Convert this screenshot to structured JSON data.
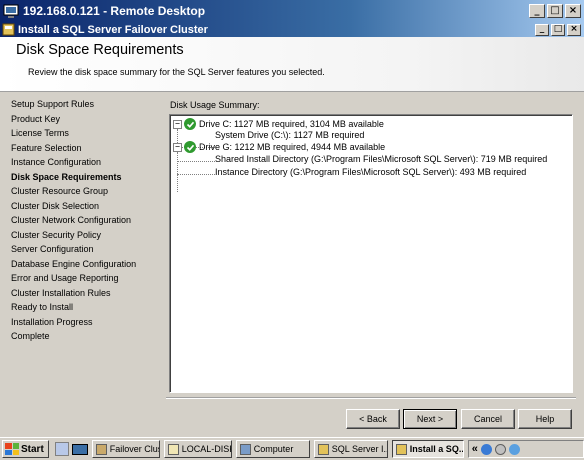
{
  "rdp_window": {
    "title": "192.168.0.121 - Remote Desktop",
    "icon": "remote-desktop-icon"
  },
  "setup_window": {
    "title": "Install a SQL Server Failover Cluster",
    "icon": "setup-icon"
  },
  "header": {
    "title": "Disk Space Requirements",
    "subtitle": "Review the disk space summary for the SQL Server features you selected."
  },
  "nav": {
    "active_index": 5,
    "items": [
      "Setup Support Rules",
      "Product Key",
      "License Terms",
      "Feature Selection",
      "Instance Configuration",
      "Disk Space Requirements",
      "Cluster Resource Group",
      "Cluster Disk Selection",
      "Cluster Network Configuration",
      "Cluster Security Policy",
      "Server Configuration",
      "Database Engine Configuration",
      "Error and Usage Reporting",
      "Cluster Installation Rules",
      "Ready to Install",
      "Installation Progress",
      "Complete"
    ]
  },
  "summary": {
    "label": "Disk Usage Summary:",
    "drives": [
      {
        "text": "Drive C: 1127 MB required, 3104 MB available",
        "status": "ok",
        "children": [
          "System Drive (C:\\): 1127 MB required"
        ]
      },
      {
        "text": "Drive G: 1212 MB required, 4944 MB available",
        "status": "ok",
        "children": [
          "Shared Install Directory (G:\\Program Files\\Microsoft SQL Server\\): 719 MB required",
          "Instance Directory (G:\\Program Files\\Microsoft SQL Server\\): 493 MB required"
        ]
      }
    ]
  },
  "buttons": {
    "back": "< Back",
    "next": "Next >",
    "cancel": "Cancel",
    "help": "Help"
  },
  "taskbar": {
    "start": "Start",
    "tasks": [
      {
        "label": "Failover Clust...",
        "active": false,
        "icon_color": "#c9a96a"
      },
      {
        "label": "LOCAL-DISK ...",
        "active": false,
        "icon_color": "#f0e6b4"
      },
      {
        "label": "Computer",
        "active": false,
        "icon_color": "#7a9cc8"
      },
      {
        "label": "SQL Server I...",
        "active": false,
        "icon_color": "#e2c25a"
      },
      {
        "label": "Install a SQ...",
        "active": true,
        "icon_color": "#e2c25a"
      }
    ],
    "tray_chevron": "«"
  },
  "colors": {
    "check_ok": "#2f9a2f",
    "title_gradient_start": "#0a246a",
    "title_gradient_end": "#a6caf0"
  }
}
